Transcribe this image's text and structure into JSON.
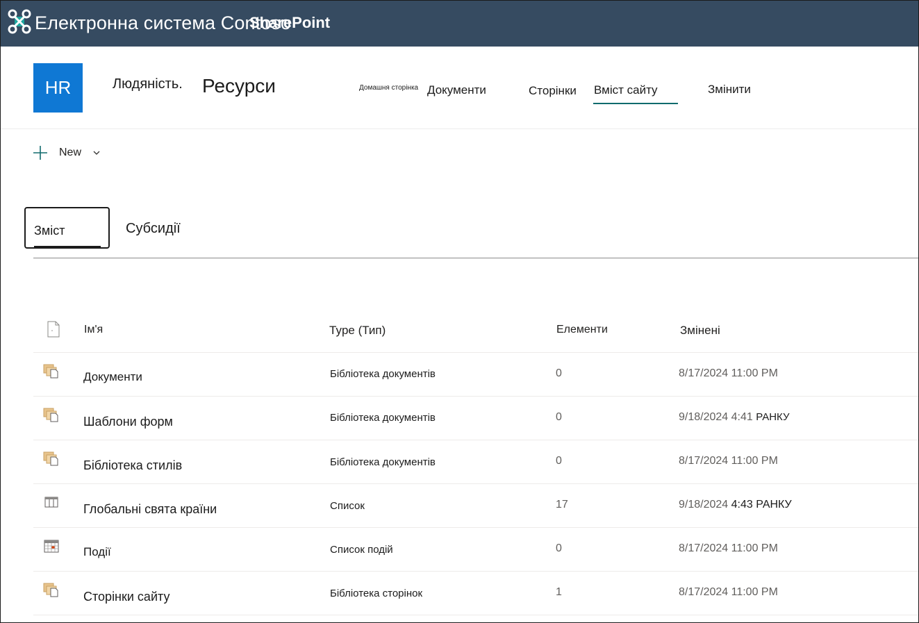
{
  "suite_bar": {
    "title": "Електронна система Contoso",
    "product": "SharePoint",
    "logo_icon": "sharepoint-knot-icon",
    "background": "#364b61"
  },
  "site": {
    "logo_text": "HR",
    "logo_color": "#0f78d4",
    "name_part1": "Людяність.",
    "name_part2": "Ресурси"
  },
  "nav": {
    "home": "Домашня сторінка",
    "documents": "Документи",
    "pages": "Сторінки",
    "site_contents": "Вміст сайту",
    "edit": "Змінити",
    "accent": "#106b6d"
  },
  "command_bar": {
    "new_label": "New",
    "new_icon": "plus-icon",
    "chevron_icon": "chevron-down-icon"
  },
  "tabs": [
    {
      "label": "Зміст",
      "active": true
    },
    {
      "label": "Субсидії",
      "active": false
    }
  ],
  "table": {
    "columns": {
      "name": "Ім'я",
      "type": "Type (Тип)",
      "items": "Елементи",
      "modified": "Змінені"
    },
    "rows": [
      {
        "icon": "document-library-icon",
        "name": "Документи",
        "type": "Бібліотека документів",
        "items": "0",
        "modified": "8/17/2024 11:00 PM",
        "modified_suffix": ""
      },
      {
        "icon": "document-library-icon",
        "name": "Шаблони форм",
        "type": "Бібліотека документів",
        "items": "0",
        "modified": "9/18/2024 4:41",
        "modified_suffix": "РАНКУ"
      },
      {
        "icon": "document-library-icon",
        "name": "Бібліотека стилів",
        "type": "Бібліотека документів",
        "items": "0",
        "modified": "8/17/2024 11:00 PM",
        "modified_suffix": ""
      },
      {
        "icon": "list-icon",
        "name": "Глобальні свята країни",
        "type": "Список",
        "items": "17",
        "modified": "9/18/2024",
        "modified_suffix": "4:43 РАНКУ"
      },
      {
        "icon": "calendar-icon",
        "name": "Події",
        "type": "Список подій",
        "items": "0",
        "modified": "8/17/2024 11:00 PM",
        "modified_suffix": ""
      },
      {
        "icon": "document-library-icon",
        "name": "Сторінки сайту",
        "type": "Бібліотека сторінок",
        "items": "1",
        "modified": "8/17/2024 11:00 PM",
        "modified_suffix": ""
      }
    ]
  }
}
